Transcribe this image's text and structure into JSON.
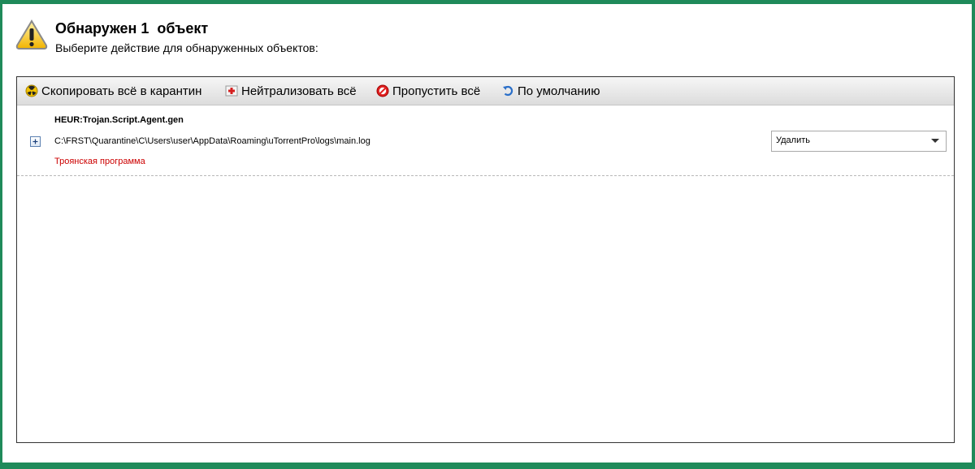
{
  "header": {
    "title": "Обнаружен 1  объект",
    "subtitle": "Выберите действие для обнаруженных объектов:",
    "icon": "warning-icon"
  },
  "toolbar": {
    "quarantine_label": "Скопировать всё в карантин",
    "neutralize_label": "Нейтрализовать всё",
    "skip_label": "Пропустить всё",
    "default_label": "По умолчанию"
  },
  "threat": {
    "name": "HEUR:Trojan.Script.Agent.gen",
    "path": "C:\\FRST\\Quarantine\\C\\Users\\user\\AppData\\Roaming\\uTorrentPro\\logs\\main.log",
    "type": "Троянская программа",
    "action": "Удалить"
  },
  "colors": {
    "frame": "#1f8a5a",
    "threat_type": "#cc0000"
  }
}
